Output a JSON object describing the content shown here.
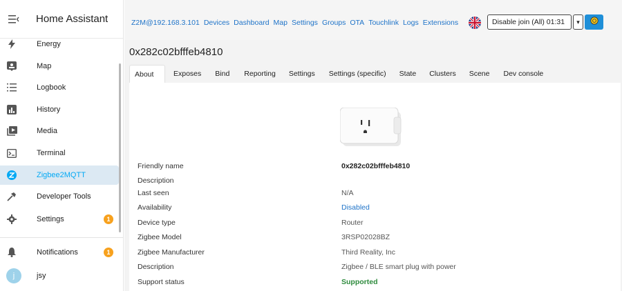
{
  "sidebar": {
    "title": "Home Assistant",
    "items": [
      {
        "label": "Energy",
        "icon": "lightning-icon"
      },
      {
        "label": "Map",
        "icon": "map-icon"
      },
      {
        "label": "Logbook",
        "icon": "list-icon"
      },
      {
        "label": "History",
        "icon": "chart-icon"
      },
      {
        "label": "Media",
        "icon": "media-icon"
      },
      {
        "label": "Terminal",
        "icon": "terminal-icon"
      },
      {
        "label": "Zigbee2MQTT",
        "icon": "zigbee-icon",
        "active": true
      },
      {
        "label": "Developer Tools",
        "icon": "hammer-icon"
      },
      {
        "label": "Settings",
        "icon": "gear-icon",
        "badge": "1"
      }
    ],
    "notifications": {
      "label": "Notifications",
      "badge": "1"
    },
    "user": {
      "initial": "j",
      "name": "jsy"
    }
  },
  "topbar": {
    "nav": [
      "Z2M@192.168.3.101",
      "Devices",
      "Dashboard",
      "Map",
      "Settings",
      "Groups",
      "OTA",
      "Touchlink",
      "Logs",
      "Extensions"
    ],
    "join_label": "Disable join (All) 01:31",
    "dropdown_glyph": "▾"
  },
  "device": {
    "title": "0x282c02bfffeb4810",
    "tabs": [
      "About",
      "Exposes",
      "Bind",
      "Reporting",
      "Settings",
      "Settings (specific)",
      "State",
      "Clusters",
      "Scene",
      "Dev console"
    ],
    "active_tab": "About",
    "fields": [
      {
        "key": "Friendly name",
        "value": "0x282c02bfffeb4810"
      },
      {
        "key": "Description",
        "value": ""
      },
      {
        "key": "Last seen",
        "value": "N/A"
      },
      {
        "key": "Availability",
        "value": "Disabled"
      },
      {
        "key": "Device type",
        "value": "Router"
      },
      {
        "key": "Zigbee Model",
        "value": "3RSP02028BZ"
      },
      {
        "key": "Zigbee Manufacturer",
        "value": "Third Reality, Inc"
      },
      {
        "key": "Description",
        "value": "Zigbee / BLE smart plug with power"
      },
      {
        "key": "Support status",
        "value": "Supported"
      }
    ]
  },
  "colors": {
    "accent": "#03a9f4",
    "link": "#1e73c8",
    "badge": "#f7a11e",
    "supported": "#2e8b3d",
    "active_bg": "#dce9f3"
  }
}
